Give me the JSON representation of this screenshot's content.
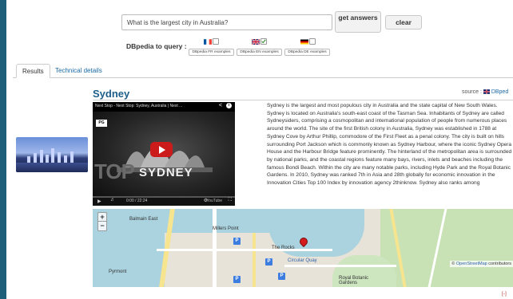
{
  "search": {
    "value": "What is the largest city in Australia?",
    "get_answers_label": "get answers",
    "clear_label": "clear"
  },
  "dbpedia": {
    "label": "DBpedia to query :",
    "endpoints": [
      {
        "lang": "FR",
        "examples_label": "DBpedia FR examples",
        "checked": false
      },
      {
        "lang": "EN",
        "examples_label": "DBpedia EN examples",
        "checked": true
      },
      {
        "lang": "DE",
        "examples_label": "DBpedia DE examples",
        "checked": false
      }
    ]
  },
  "tabs": [
    {
      "label": "Results",
      "active": true
    },
    {
      "label": "Technical details",
      "active": false
    }
  ],
  "result": {
    "title": "Sydney",
    "source_prefix": "source :",
    "source_link": "DBped",
    "abstract": "Sydney is the largest and most populous city in Australia and the state capital of New South Wales. Sydney is located on Australia's south-east coast of the Tasman Sea. Inhabitants of Sydney are called Sydneysiders, comprising a cosmopolitan and international population of people from numerous places around the world. The site of the first British colony in Australia, Sydney was established in 1788 at Sydney Cove by Arthur Phillip, commodore of the First Fleet as a penal colony. The city is built on hills surrounding Port Jackson which is commonly known as Sydney Harbour, where the iconic Sydney Opera House and the Harbour Bridge feature prominently. The hinterland of the metropolitan area is surrounded by national parks, and the coastal regions feature many bays, rivers, inlets and beaches including the famous Bondi Beach. Within the city are many notable parks, including Hyde Park and the Royal Botanic Gardens. In 2010, Sydney was ranked 7th in Asia and 28th globally for economic innovation in the Innovation Cities Top 100 Index by innovation agency 2thinknow. Sydney also ranks among"
  },
  "video": {
    "title": "Next Stop - Next Stop: Sydney, Australia | Next ...",
    "rating": "PG",
    "overlay_top": "TOP",
    "overlay_city": "SYDNEY",
    "time": "0:00 / 22:24",
    "brand": "YouTube"
  },
  "map": {
    "zoom_in": "+",
    "zoom_out": "−",
    "attribution_prefix": "©",
    "attribution_link": "OpenStreetMap",
    "attribution_suffix": "contributors",
    "labels": {
      "balmain_east": "Balmain East",
      "millers_point": "Millers Point",
      "the_rocks": "The Rocks",
      "circular_quay": "Circular Quay",
      "royal_botanic": "Royal Botanic\nGardens",
      "pyrmont": "Pyrmont"
    }
  },
  "collapse_label": "[-]"
}
